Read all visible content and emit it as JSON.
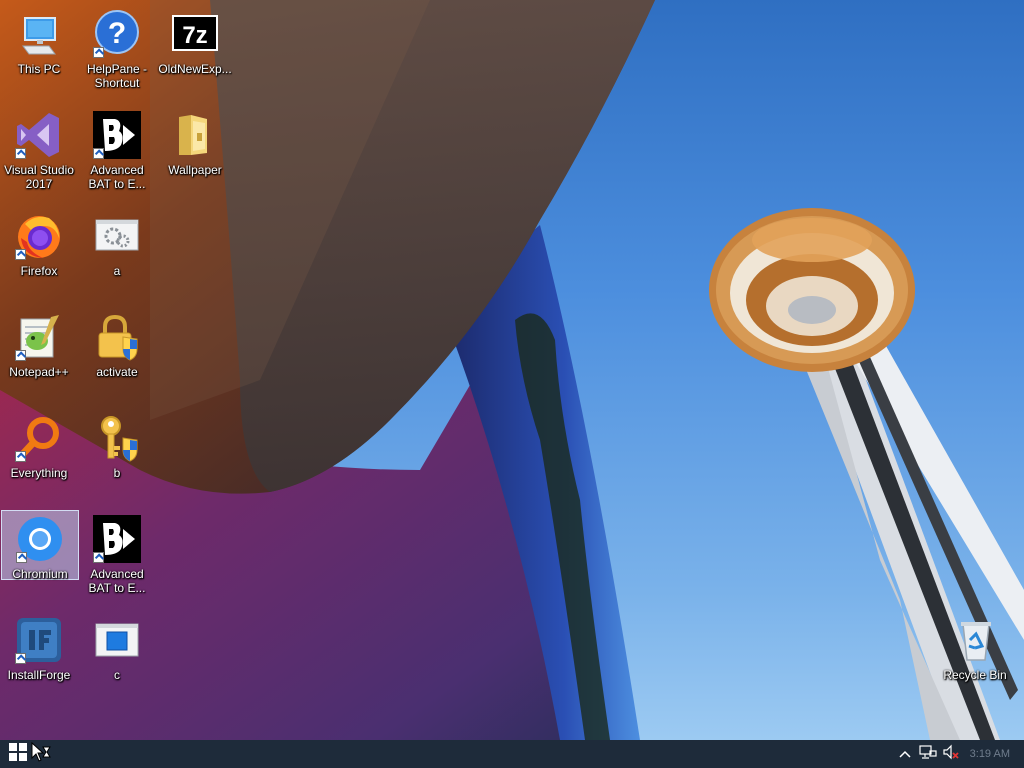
{
  "desktop": {
    "icons": [
      {
        "label": "This PC"
      },
      {
        "label": "HelpPane - Shortcut"
      },
      {
        "label": "OldNewExp..."
      },
      {
        "label": "Visual Studio 2017"
      },
      {
        "label": "Advanced BAT to E..."
      },
      {
        "label": "Wallpaper"
      },
      {
        "label": "Firefox"
      },
      {
        "label": "a"
      },
      {
        "label": "Notepad++"
      },
      {
        "label": "activate"
      },
      {
        "label": "Everything"
      },
      {
        "label": "b"
      },
      {
        "label": "Chromium"
      },
      {
        "label": "Advanced BAT to E..."
      },
      {
        "label": "InstallForge"
      },
      {
        "label": "c"
      },
      {
        "label": "Recycle Bin"
      }
    ],
    "seven_zip_text": "7z"
  },
  "taskbar": {
    "clock": "3:19 AM",
    "icons": [
      "windows-logo-icon",
      "busy-cursor-icon",
      "chevron-up-icon",
      "network-icon",
      "volume-muted-icon"
    ]
  },
  "colors": {
    "taskbar": "#1e2b3a",
    "sky": "#4d8fde",
    "accent": "#1f5fbf"
  }
}
